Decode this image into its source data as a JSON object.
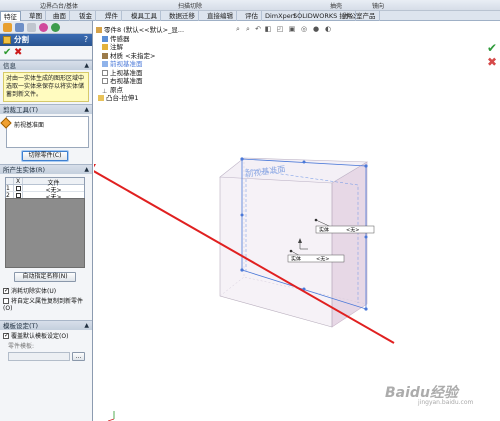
{
  "ribbon": {
    "items": [
      "边界凸台/基体",
      "扫描切除",
      "抽壳",
      "镜向"
    ]
  },
  "tabs": [
    "特征",
    "草图",
    "曲面",
    "钣金",
    "焊件",
    "模具工具",
    "数据迁移",
    "直接编辑",
    "评估",
    "DimXpert",
    "SOLIDWORKS 插件",
    "办公室产品"
  ],
  "panel": {
    "title": "分割",
    "help": "?",
    "message_group": "信息",
    "message": "对由一实体生成的图形区域中选取一实体来保存以将实体储蓄到新文件。",
    "trim_group": "剪裁工具(T)",
    "trim_item": "前视基准面",
    "cut_button": "切除零件(C)",
    "bodies_group": "所产生实体(R)",
    "table_header_x": "X",
    "table_header_file": "文件",
    "table_rows": [
      {
        "num": "1",
        "file": "<无>"
      },
      {
        "num": "2",
        "file": "<无>"
      }
    ],
    "auto_name_button": "自动指定名称(N)",
    "option_consume": "消耗切除实体(U)",
    "option_propagate": "将自定义属性复制到新零件(O)",
    "template_group": "模板设定(T)",
    "template_override": "覆盖默认模板设定(O)",
    "template_label": "零件模板:",
    "browse_button": "..."
  },
  "tree": {
    "root": "零件8 (默认<<默认>_显...",
    "items": [
      "传感器",
      "注解",
      "材质 <未指定>",
      "前视基准面",
      "上视基准面",
      "右视基准面",
      "原点",
      "凸台-拉伸1"
    ]
  },
  "view": {
    "plane_label": "前视基准面",
    "callout1_label": "实体",
    "callout1_value": "<无>",
    "callout2_label": "实体",
    "callout2_value": "<无>"
  },
  "watermark": {
    "brand": "Baidu经验",
    "url": "jingyan.baidu.com"
  },
  "colors": {
    "arrow": "#e02020",
    "panel_title": "#2f5e9e",
    "plane_edge": "#4a78d8"
  }
}
